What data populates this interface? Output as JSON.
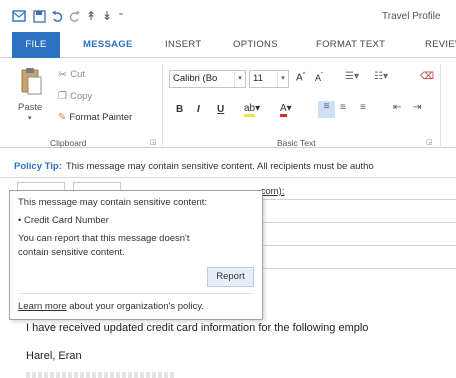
{
  "window": {
    "title": "Travel Profile"
  },
  "quick_access": {
    "icons": [
      "outlook-icon",
      "save-icon",
      "undo-icon",
      "redo-icon",
      "up-arrow-icon",
      "down-arrow-icon",
      "customize-icon"
    ]
  },
  "tabs": [
    {
      "label": "FILE"
    },
    {
      "label": "MESSAGE"
    },
    {
      "label": "INSERT"
    },
    {
      "label": "OPTIONS"
    },
    {
      "label": "FORMAT TEXT"
    },
    {
      "label": "REVIEW"
    }
  ],
  "ribbon": {
    "clipboard": {
      "paste": "Paste",
      "cut": "Cut",
      "copy": "Copy",
      "format_painter": "Format Painter",
      "group_label": "Clipboard"
    },
    "basic_text": {
      "font_name": "Calibri (Bo",
      "font_size": "11",
      "group_label": "Basic Text"
    }
  },
  "policy_tip": {
    "label": "Policy Tip:",
    "text": "This message may contain sensitive content. All recipients must be autho"
  },
  "address_fragment": ".com);",
  "popup": {
    "line1": "This message may contain sensitive content:",
    "line2": "• Credit Card Number",
    "line3": "You can report that this message doesn't",
    "line4": "contain sensitive content.",
    "report": "Report",
    "learn_more": "Learn more",
    "learn_more_rest": " about your organization's policy."
  },
  "body": {
    "line1": "I have received updated credit card information for the following emplo",
    "line2": "Harel, Eran"
  },
  "colors": {
    "accent": "#2b72c2"
  }
}
